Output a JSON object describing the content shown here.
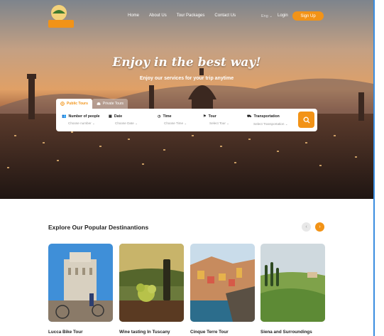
{
  "nav": {
    "logo_text": "Tours & Tuscany",
    "menu": [
      "Home",
      "About Us",
      "Tour Packages",
      "Contact Us"
    ],
    "language": "Eng",
    "login": "Login",
    "signup": "Sign Up"
  },
  "hero": {
    "headline": "Enjoy in the best way!",
    "subline": "Enjoy our services for your trip anytime"
  },
  "search": {
    "tabs": [
      "Public Tours",
      "Private Tours"
    ],
    "fields": [
      {
        "label": "Number of people",
        "value": "Choose number",
        "icon": "people-icon"
      },
      {
        "label": "Date",
        "value": "Choose Date",
        "icon": "calendar-icon"
      },
      {
        "label": "Time",
        "value": "Choose Time",
        "icon": "clock-icon"
      },
      {
        "label": "Tour",
        "value": "Select Tour",
        "icon": "flag-icon"
      },
      {
        "label": "Transportation",
        "value": "Select Transportation",
        "icon": "bus-icon"
      }
    ]
  },
  "destinations": {
    "title": "Explore Our Popular Destinantions",
    "cards": [
      {
        "name": "Lucca Bike Tour"
      },
      {
        "name": "Wine tasting In Tuscany"
      },
      {
        "name": "Cinque Terre Tour"
      },
      {
        "name": "Siena and Surroundings"
      }
    ]
  },
  "colors": {
    "accent": "#f29317",
    "border": "#3a8de0"
  }
}
